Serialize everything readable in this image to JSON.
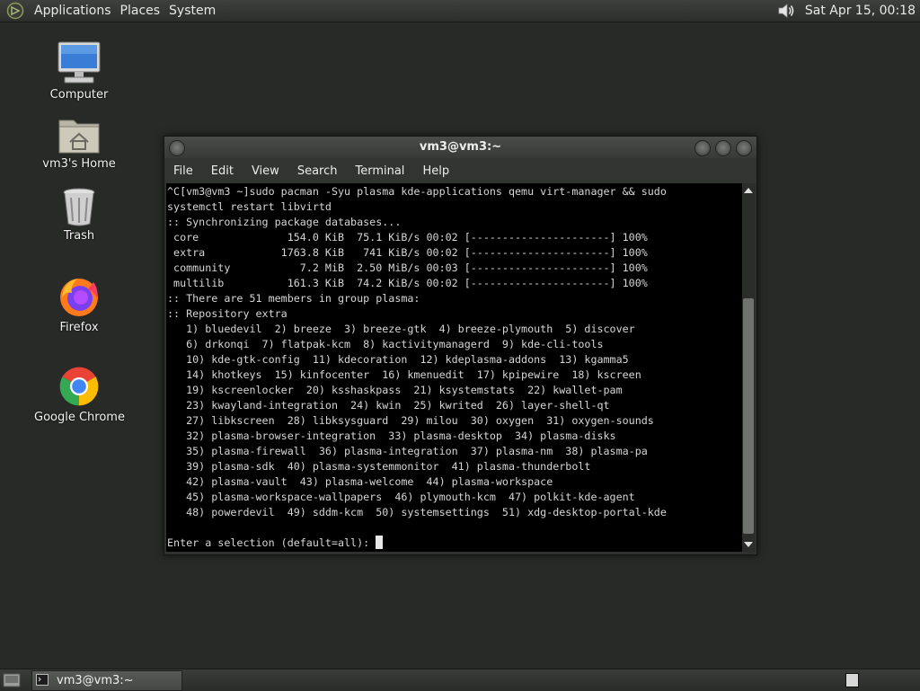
{
  "top_panel": {
    "menus": [
      "Applications",
      "Places",
      "System"
    ],
    "clock": "Sat Apr 15, 00:18"
  },
  "desktop": {
    "icons": [
      {
        "label": "Computer",
        "icon": "computer-icon"
      },
      {
        "label": "vm3's Home",
        "icon": "home-folder-icon"
      },
      {
        "label": "Trash",
        "icon": "trash-icon"
      },
      {
        "label": "Firefox",
        "icon": "firefox-icon"
      },
      {
        "label": "Google Chrome",
        "icon": "chrome-icon"
      }
    ]
  },
  "terminal": {
    "title": "vm3@vm3:~",
    "menus": [
      "File",
      "Edit",
      "View",
      "Search",
      "Terminal",
      "Help"
    ],
    "lines": [
      "^C[vm3@vm3 ~]sudo pacman -Syu plasma kde-applications qemu virt-manager && sudo",
      "systemctl restart libvirtd",
      ":: Synchronizing package databases...",
      " core              154.0 KiB  75.1 KiB/s 00:02 [----------------------] 100%",
      " extra            1763.8 KiB   741 KiB/s 00:02 [----------------------] 100%",
      " community           7.2 MiB  2.50 MiB/s 00:03 [----------------------] 100%",
      " multilib          161.3 KiB  74.2 KiB/s 00:02 [----------------------] 100%",
      ":: There are 51 members in group plasma:",
      ":: Repository extra",
      "   1) bluedevil  2) breeze  3) breeze-gtk  4) breeze-plymouth  5) discover",
      "   6) drkonqi  7) flatpak-kcm  8) kactivitymanagerd  9) kde-cli-tools",
      "   10) kde-gtk-config  11) kdecoration  12) kdeplasma-addons  13) kgamma5",
      "   14) khotkeys  15) kinfocenter  16) kmenuedit  17) kpipewire  18) kscreen",
      "   19) kscreenlocker  20) ksshaskpass  21) ksystemstats  22) kwallet-pam",
      "   23) kwayland-integration  24) kwin  25) kwrited  26) layer-shell-qt",
      "   27) libkscreen  28) libksysguard  29) milou  30) oxygen  31) oxygen-sounds",
      "   32) plasma-browser-integration  33) plasma-desktop  34) plasma-disks",
      "   35) plasma-firewall  36) plasma-integration  37) plasma-nm  38) plasma-pa",
      "   39) plasma-sdk  40) plasma-systemmonitor  41) plasma-thunderbolt",
      "   42) plasma-vault  43) plasma-welcome  44) plasma-workspace",
      "   45) plasma-workspace-wallpapers  46) plymouth-kcm  47) polkit-kde-agent",
      "   48) powerdevil  49) sddm-kcm  50) systemsettings  51) xdg-desktop-portal-kde",
      "",
      "Enter a selection (default=all): "
    ]
  },
  "taskbar": {
    "window_button": "vm3@vm3:~"
  }
}
